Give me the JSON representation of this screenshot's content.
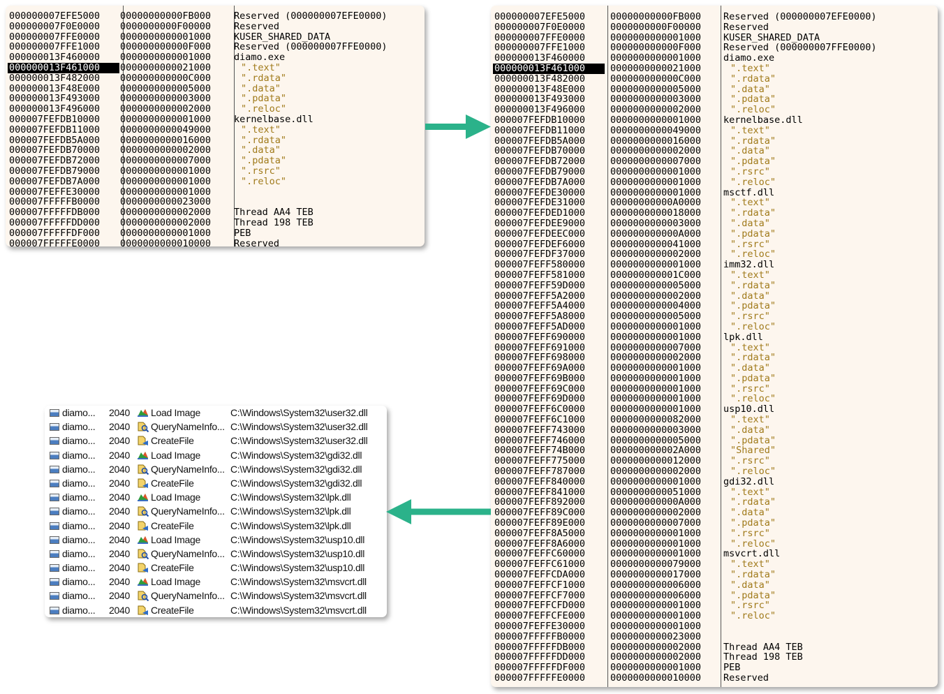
{
  "memory_map_small": {
    "selected_index": 5,
    "rows": [
      [
        "000000007EFE5000",
        "00000000000FB000",
        "Reserved (000000007EFE0000)",
        0
      ],
      [
        "000000007F0E0000",
        "0000000000F00000",
        "Reserved",
        0
      ],
      [
        "000000007FFE0000",
        "0000000000001000",
        "KUSER_SHARED_DATA",
        0
      ],
      [
        "000000007FFE1000",
        "000000000000F000",
        "Reserved (000000007FFE0000)",
        0
      ],
      [
        "000000013F460000",
        "0000000000001000",
        "diamo.exe",
        0
      ],
      [
        "000000013F461000",
        "0000000000021000",
        "\".text\"",
        1
      ],
      [
        "000000013F482000",
        "000000000000C000",
        "\".rdata\"",
        1
      ],
      [
        "000000013F48E000",
        "0000000000005000",
        "\".data\"",
        1
      ],
      [
        "000000013F493000",
        "0000000000003000",
        "\".pdata\"",
        1
      ],
      [
        "000000013F496000",
        "0000000000002000",
        "\".reloc\"",
        1
      ],
      [
        "000007FEFDB10000",
        "0000000000001000",
        "kernelbase.dll",
        0
      ],
      [
        "000007FEFDB11000",
        "0000000000049000",
        "\".text\"",
        1
      ],
      [
        "000007FEFDB5A000",
        "0000000000016000",
        "\".rdata\"",
        1
      ],
      [
        "000007FEFDB70000",
        "0000000000002000",
        "\".data\"",
        1
      ],
      [
        "000007FEFDB72000",
        "0000000000007000",
        "\".pdata\"",
        1
      ],
      [
        "000007FEFDB79000",
        "0000000000001000",
        "\".rsrc\"",
        1
      ],
      [
        "000007FEFDB7A000",
        "0000000000001000",
        "\".reloc\"",
        1
      ],
      [
        "000007FEFFE30000",
        "0000000000001000",
        "",
        0
      ],
      [
        "000007FFFFFB0000",
        "0000000000023000",
        "",
        0
      ],
      [
        "000007FFFFFDB000",
        "0000000000002000",
        "Thread AA4 TEB",
        0
      ],
      [
        "000007FFFFFDD000",
        "0000000000002000",
        "Thread 198 TEB",
        0
      ],
      [
        "000007FFFFFDF000",
        "0000000000001000",
        "PEB",
        0
      ],
      [
        "000007FFFFFE0000",
        "0000000000010000",
        "Reserved",
        0
      ]
    ]
  },
  "memory_map_large": {
    "selected_index": 5,
    "rows": [
      [
        "000000007EFE5000",
        "00000000000FB000",
        "Reserved (000000007EFE0000)",
        0
      ],
      [
        "000000007F0E0000",
        "0000000000F00000",
        "Reserved",
        0
      ],
      [
        "000000007FFE0000",
        "0000000000001000",
        "KUSER_SHARED_DATA",
        0
      ],
      [
        "000000007FFE1000",
        "000000000000F000",
        "Reserved (000000007FFE0000)",
        0
      ],
      [
        "000000013F460000",
        "0000000000001000",
        "diamo.exe",
        0
      ],
      [
        "000000013F461000",
        "0000000000021000",
        "\".text\"",
        1
      ],
      [
        "000000013F482000",
        "000000000000C000",
        "\".rdata\"",
        1
      ],
      [
        "000000013F48E000",
        "0000000000005000",
        "\".data\"",
        1
      ],
      [
        "000000013F493000",
        "0000000000003000",
        "\".pdata\"",
        1
      ],
      [
        "000000013F496000",
        "0000000000002000",
        "\".reloc\"",
        1
      ],
      [
        "000007FEFDB10000",
        "0000000000001000",
        "kernelbase.dll",
        0
      ],
      [
        "000007FEFDB11000",
        "0000000000049000",
        "\".text\"",
        1
      ],
      [
        "000007FEFDB5A000",
        "0000000000016000",
        "\".rdata\"",
        1
      ],
      [
        "000007FEFDB70000",
        "0000000000002000",
        "\".data\"",
        1
      ],
      [
        "000007FEFDB72000",
        "0000000000007000",
        "\".pdata\"",
        1
      ],
      [
        "000007FEFDB79000",
        "0000000000001000",
        "\".rsrc\"",
        1
      ],
      [
        "000007FEFDB7A000",
        "0000000000001000",
        "\".reloc\"",
        1
      ],
      [
        "000007FEFDE30000",
        "0000000000001000",
        "msctf.dll",
        0
      ],
      [
        "000007FEFDE31000",
        "00000000000A0000",
        "\".text\"",
        1
      ],
      [
        "000007FEFDED1000",
        "0000000000018000",
        "\".rdata\"",
        1
      ],
      [
        "000007FEFDEE9000",
        "0000000000003000",
        "\".data\"",
        1
      ],
      [
        "000007FEFDEEC000",
        "000000000000A000",
        "\".pdata\"",
        1
      ],
      [
        "000007FEFDEF6000",
        "0000000000041000",
        "\".rsrc\"",
        1
      ],
      [
        "000007FEFDF37000",
        "0000000000002000",
        "\".reloc\"",
        1
      ],
      [
        "000007FEFF580000",
        "0000000000001000",
        "imm32.dll",
        0
      ],
      [
        "000007FEFF581000",
        "000000000001C000",
        "\".text\"",
        1
      ],
      [
        "000007FEFF59D000",
        "0000000000005000",
        "\".rdata\"",
        1
      ],
      [
        "000007FEFF5A2000",
        "0000000000002000",
        "\".data\"",
        1
      ],
      [
        "000007FEFF5A4000",
        "0000000000004000",
        "\".pdata\"",
        1
      ],
      [
        "000007FEFF5A8000",
        "0000000000005000",
        "\".rsrc\"",
        1
      ],
      [
        "000007FEFF5AD000",
        "0000000000001000",
        "\".reloc\"",
        1
      ],
      [
        "000007FEFF690000",
        "0000000000001000",
        "lpk.dll",
        0
      ],
      [
        "000007FEFF691000",
        "0000000000007000",
        "\".text\"",
        1
      ],
      [
        "000007FEFF698000",
        "0000000000002000",
        "\".rdata\"",
        1
      ],
      [
        "000007FEFF69A000",
        "0000000000001000",
        "\".data\"",
        1
      ],
      [
        "000007FEFF69B000",
        "0000000000001000",
        "\".pdata\"",
        1
      ],
      [
        "000007FEFF69C000",
        "0000000000001000",
        "\".rsrc\"",
        1
      ],
      [
        "000007FEFF69D000",
        "0000000000001000",
        "\".reloc\"",
        1
      ],
      [
        "000007FEFF6C0000",
        "0000000000001000",
        "usp10.dll",
        0
      ],
      [
        "000007FEFF6C1000",
        "0000000000082000",
        "\".text\"",
        1
      ],
      [
        "000007FEFF743000",
        "0000000000003000",
        "\".data\"",
        1
      ],
      [
        "000007FEFF746000",
        "0000000000005000",
        "\".pdata\"",
        1
      ],
      [
        "000007FEFF74B000",
        "000000000002A000",
        "\"Shared\"",
        1
      ],
      [
        "000007FEFF775000",
        "0000000000012000",
        "\".rsrc\"",
        1
      ],
      [
        "000007FEFF787000",
        "0000000000002000",
        "\".reloc\"",
        1
      ],
      [
        "000007FEFF840000",
        "0000000000001000",
        "gdi32.dll",
        0
      ],
      [
        "000007FEFF841000",
        "0000000000051000",
        "\".text\"",
        1
      ],
      [
        "000007FEFF892000",
        "000000000000A000",
        "\".rdata\"",
        1
      ],
      [
        "000007FEFF89C000",
        "0000000000002000",
        "\".data\"",
        1
      ],
      [
        "000007FEFF89E000",
        "0000000000007000",
        "\".pdata\"",
        1
      ],
      [
        "000007FEFF8A5000",
        "0000000000001000",
        "\".rsrc\"",
        1
      ],
      [
        "000007FEFF8A6000",
        "0000000000001000",
        "\".reloc\"",
        1
      ],
      [
        "000007FEFFC60000",
        "0000000000001000",
        "msvcrt.dll",
        0
      ],
      [
        "000007FEFFC61000",
        "0000000000079000",
        "\".text\"",
        1
      ],
      [
        "000007FEFFCDA000",
        "0000000000017000",
        "\".rdata\"",
        1
      ],
      [
        "000007FEFFCF1000",
        "0000000000006000",
        "\".data\"",
        1
      ],
      [
        "000007FEFFCF7000",
        "0000000000006000",
        "\".pdata\"",
        1
      ],
      [
        "000007FEFFCFD000",
        "0000000000001000",
        "\".rsrc\"",
        1
      ],
      [
        "000007FEFFCFE000",
        "0000000000001000",
        "\".reloc\"",
        1
      ],
      [
        "000007FEFFE30000",
        "0000000000001000",
        "",
        0
      ],
      [
        "000007FFFFFB0000",
        "0000000000023000",
        "",
        0
      ],
      [
        "000007FFFFFDB000",
        "0000000000002000",
        "Thread AA4 TEB",
        0
      ],
      [
        "000007FFFFFDD000",
        "0000000000002000",
        "Thread 198 TEB",
        0
      ],
      [
        "000007FFFFFDF000",
        "0000000000001000",
        "PEB",
        0
      ],
      [
        "000007FFFFFE0000",
        "0000000000010000",
        "Reserved",
        0
      ]
    ]
  },
  "procmon": {
    "icons": {
      "load": "load-image-icon",
      "query": "query-name-info-icon",
      "create": "create-file-icon",
      "process": "process-icon"
    },
    "rows": [
      [
        "diamo...",
        "2040",
        "load",
        "Load Image",
        "C:\\Windows\\System32\\user32.dll"
      ],
      [
        "diamo...",
        "2040",
        "query",
        "QueryNameInfo...",
        "C:\\Windows\\System32\\user32.dll"
      ],
      [
        "diamo...",
        "2040",
        "create",
        "CreateFile",
        "C:\\Windows\\System32\\user32.dll"
      ],
      [
        "diamo...",
        "2040",
        "load",
        "Load Image",
        "C:\\Windows\\System32\\gdi32.dll"
      ],
      [
        "diamo...",
        "2040",
        "query",
        "QueryNameInfo...",
        "C:\\Windows\\System32\\gdi32.dll"
      ],
      [
        "diamo...",
        "2040",
        "create",
        "CreateFile",
        "C:\\Windows\\System32\\gdi32.dll"
      ],
      [
        "diamo...",
        "2040",
        "load",
        "Load Image",
        "C:\\Windows\\System32\\lpk.dll"
      ],
      [
        "diamo...",
        "2040",
        "query",
        "QueryNameInfo...",
        "C:\\Windows\\System32\\lpk.dll"
      ],
      [
        "diamo...",
        "2040",
        "create",
        "CreateFile",
        "C:\\Windows\\System32\\lpk.dll"
      ],
      [
        "diamo...",
        "2040",
        "load",
        "Load Image",
        "C:\\Windows\\System32\\usp10.dll"
      ],
      [
        "diamo...",
        "2040",
        "query",
        "QueryNameInfo...",
        "C:\\Windows\\System32\\usp10.dll"
      ],
      [
        "diamo...",
        "2040",
        "create",
        "CreateFile",
        "C:\\Windows\\System32\\usp10.dll"
      ],
      [
        "diamo...",
        "2040",
        "load",
        "Load Image",
        "C:\\Windows\\System32\\msvcrt.dll"
      ],
      [
        "diamo...",
        "2040",
        "query",
        "QueryNameInfo...",
        "C:\\Windows\\System32\\msvcrt.dll"
      ],
      [
        "diamo...",
        "2040",
        "create",
        "CreateFile",
        "C:\\Windows\\System32\\msvcrt.dll"
      ]
    ]
  },
  "arrows": {
    "color": "#2bb28a"
  }
}
